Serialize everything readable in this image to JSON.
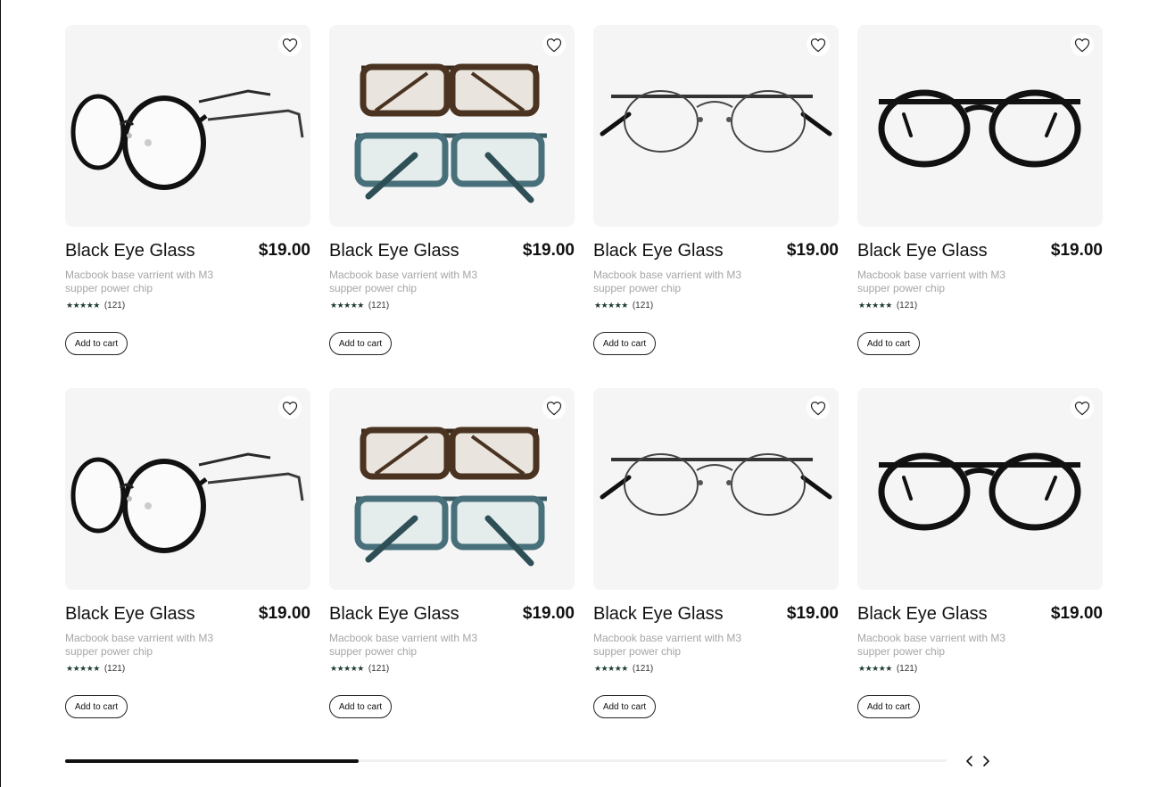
{
  "products": [
    {
      "title": "Black Eye Glass",
      "price": "$19.00",
      "description": "Macbook base varrient with M3 supper power chip",
      "stars": "★★★★★",
      "reviews": "(121)",
      "cart_label": "Add to cart",
      "image": "black-round-metal-arm-glasses"
    },
    {
      "title": "Black Eye Glass",
      "price": "$19.00",
      "description": "Macbook base varrient with M3 supper power chip",
      "stars": "★★★★★",
      "reviews": "(121)",
      "cart_label": "Add to cart",
      "image": "tortoise-and-teal-rectangular-glasses"
    },
    {
      "title": "Black Eye Glass",
      "price": "$19.00",
      "description": "Macbook base varrient with M3 supper power chip",
      "stars": "★★★★★",
      "reviews": "(121)",
      "cart_label": "Add to cart",
      "image": "thin-wire-round-glasses"
    },
    {
      "title": "Black Eye Glass",
      "price": "$19.00",
      "description": "Macbook base varrient with M3 supper power chip",
      "stars": "★★★★★",
      "reviews": "(121)",
      "cart_label": "Add to cart",
      "image": "black-round-thick-glasses"
    },
    {
      "title": "Black Eye Glass",
      "price": "$19.00",
      "description": "Macbook base varrient with M3 supper power chip",
      "stars": "★★★★★",
      "reviews": "(121)",
      "cart_label": "Add to cart",
      "image": "black-round-metal-arm-glasses"
    },
    {
      "title": "Black Eye Glass",
      "price": "$19.00",
      "description": "Macbook base varrient with M3 supper power chip",
      "stars": "★★★★★",
      "reviews": "(121)",
      "cart_label": "Add to cart",
      "image": "tortoise-and-teal-rectangular-glasses"
    },
    {
      "title": "Black Eye Glass",
      "price": "$19.00",
      "description": "Macbook base varrient with M3 supper power chip",
      "stars": "★★★★★",
      "reviews": "(121)",
      "cart_label": "Add to cart",
      "image": "thin-wire-round-glasses"
    },
    {
      "title": "Black Eye Glass",
      "price": "$19.00",
      "description": "Macbook base varrient with M3 supper power chip",
      "stars": "★★★★★",
      "reviews": "(121)",
      "cart_label": "Add to cart",
      "image": "black-round-thick-glasses"
    }
  ],
  "carousel": {
    "progress": 0.333,
    "prev_icon": "chevron-left-icon",
    "next_icon": "chevron-right-icon"
  },
  "colors": {
    "star": "#1f3d2e",
    "card_background": "#f5f5f5",
    "description_text": "#a6a6a6",
    "scroll_thumb": "#111111",
    "scroll_track": "#f0f0f0"
  }
}
